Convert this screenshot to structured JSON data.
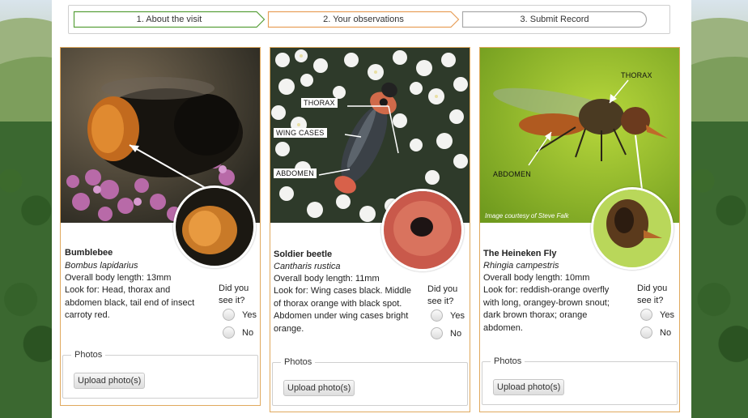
{
  "progress": {
    "steps": [
      {
        "label": "1. About the visit",
        "color": "#5aa03c"
      },
      {
        "label": "2. Your observations",
        "color": "#e8a05c"
      },
      {
        "label": "3. Submit Record",
        "color": "#aaaaaa"
      }
    ]
  },
  "cards": [
    {
      "title": "Bumblebee",
      "latin": "Bombus lapidarius",
      "length": "Overall body length: 13mm",
      "look_for": "Look for: Head, thorax and abdomen black, tail end of insect carroty red.",
      "seen_question": "Did you see it?",
      "yes_label": "Yes",
      "no_label": "No",
      "photos_legend": "Photos",
      "upload_label": "Upload photo(s)"
    },
    {
      "title": "Soldier beetle",
      "latin": "Cantharis rustica",
      "length": "Overall body length: 11mm",
      "look_for": "Look for: Wing cases black. Middle of thorax orange with black spot. Abdomen under wing cases bright orange.",
      "seen_question": "Did you see it?",
      "yes_label": "Yes",
      "no_label": "No",
      "photos_legend": "Photos",
      "upload_label": "Upload photo(s)",
      "photo_labels": {
        "thorax": "THORAX",
        "wing_cases": "WING CASES",
        "abdomen": "ABDOMEN"
      }
    },
    {
      "title": "The Heineken Fly",
      "latin": "Rhingia campestris",
      "length": "Overall body length: 10mm",
      "look_for": "Look for: reddish-orange overfly with long, orangey-brown snout; dark brown thorax; orange abdomen.",
      "seen_question": "Did you see it?",
      "yes_label": "Yes",
      "no_label": "No",
      "photos_legend": "Photos",
      "upload_label": "Upload photo(s)",
      "photo_labels": {
        "thorax": "THORAX",
        "abdomen": "ABDOMEN"
      },
      "credit": "Image courtesy of Steve Falk"
    }
  ],
  "accent_border": "#e0a95e"
}
